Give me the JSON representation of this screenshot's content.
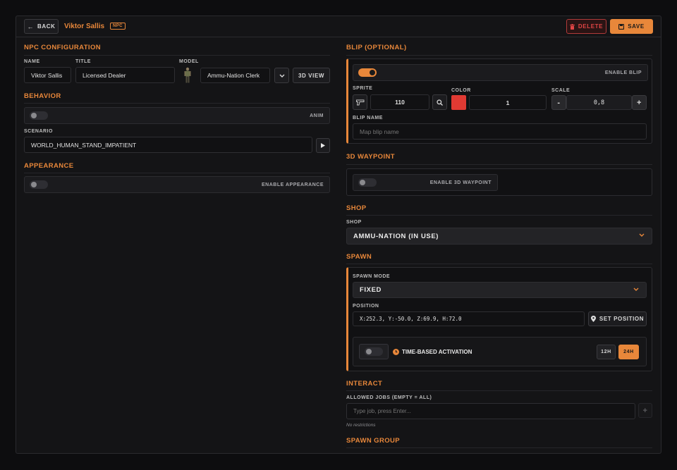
{
  "header": {
    "back_label": "BACK",
    "npc_name": "Viktor Sallis",
    "npc_badge": "NPC",
    "delete_label": "DELETE",
    "save_label": "SAVE"
  },
  "npc_config": {
    "title": "NPC CONFIGURATION",
    "name_label": "NAME",
    "name_value": "Viktor Sallis",
    "title_label": "TITLE",
    "title_value": "Licensed Dealer",
    "model_label": "MODEL",
    "model_value": "Ammu-Nation Clerk",
    "view3d_label": "3D VIEW"
  },
  "behavior": {
    "title": "BEHAVIOR",
    "anim_label": "ANIM",
    "anim_enabled": false,
    "scenario_label": "SCENARIO",
    "scenario_value": "WORLD_HUMAN_STAND_IMPATIENT"
  },
  "appearance": {
    "title": "APPEARANCE",
    "enable_label": "ENABLE APPEARANCE",
    "enabled": false
  },
  "blip": {
    "title": "BLIP (OPTIONAL)",
    "enable_label": "ENABLE BLIP",
    "enabled": true,
    "sprite_label": "SPRITE",
    "sprite_value": "110",
    "color_label": "COLOR",
    "color_swatch": "#e03a33",
    "color_value": "1",
    "scale_label": "SCALE",
    "scale_minus": "-",
    "scale_value": "0,8",
    "scale_plus": "+",
    "name_label": "BLIP NAME",
    "name_placeholder": "Map blip name"
  },
  "waypoint": {
    "title": "3D WAYPOINT",
    "enable_label": "ENABLE 3D WAYPOINT",
    "enabled": false
  },
  "shop": {
    "title": "SHOP",
    "label": "SHOP",
    "value": "AMMU-NATION (IN USE)"
  },
  "spawn": {
    "title": "SPAWN",
    "mode_label": "SPAWN MODE",
    "mode_value": "FIXED",
    "position_label": "POSITION",
    "position_value": "X:252.3, Y:-50.0, Z:69.9, H:72.0",
    "set_position_label": "SET POSITION",
    "time_label": "TIME-BASED ACTIVATION",
    "time_enabled": false,
    "h12_label": "12H",
    "h24_label": "24H"
  },
  "interact": {
    "title": "INTERACT",
    "jobs_label": "ALLOWED JOBS (EMPTY = ALL)",
    "jobs_placeholder": "Type job, press Enter...",
    "add_label": "+",
    "note": "No restrictions"
  },
  "spawn_group": {
    "title": "SPAWN GROUP"
  },
  "colors": {
    "accent": "#e8873a",
    "danger": "#e04545",
    "panel": "#141416"
  }
}
